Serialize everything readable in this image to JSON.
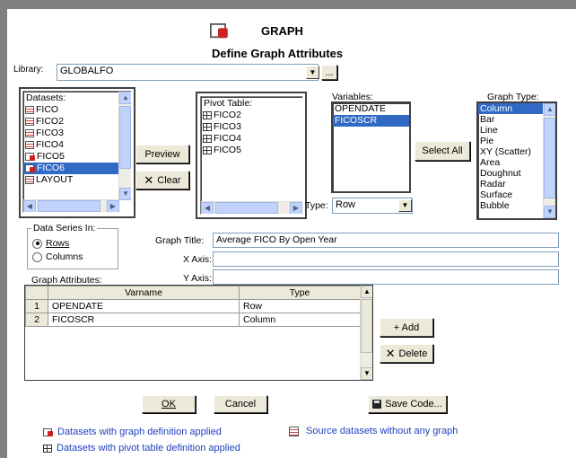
{
  "header": {
    "app_title": "GRAPH",
    "subtitle": "Define Graph Attributes"
  },
  "library": {
    "label": "Library:",
    "value": "GLOBALFO",
    "browse_label": "..."
  },
  "datasets": {
    "label": "Datasets:",
    "items": [
      {
        "name": "FICO",
        "icon": "source-dataset-icon",
        "selected": false
      },
      {
        "name": "FICO2",
        "icon": "source-dataset-icon",
        "selected": false
      },
      {
        "name": "FICO3",
        "icon": "source-dataset-icon",
        "selected": false
      },
      {
        "name": "FICO4",
        "icon": "source-dataset-icon",
        "selected": false
      },
      {
        "name": "FICO5",
        "icon": "graph-dataset-icon",
        "selected": false
      },
      {
        "name": "FICO6",
        "icon": "graph-dataset-icon",
        "selected": true
      },
      {
        "name": "LAYOUT",
        "icon": "source-dataset-icon",
        "selected": false
      }
    ]
  },
  "buttons": {
    "preview": "Preview",
    "clear": "Clear",
    "select_all": "Select All",
    "add": "+ Add",
    "delete": "Delete",
    "ok": "OK",
    "cancel": "Cancel",
    "save_code": "Save Code..."
  },
  "pivot_table": {
    "label": "Pivot Table:",
    "items": [
      "FICO2",
      "FICO3",
      "FICO4",
      "FICO5"
    ]
  },
  "variables": {
    "label": "Variables:",
    "items": [
      {
        "name": "OPENDATE",
        "selected": false
      },
      {
        "name": "FICOSCR",
        "selected": true
      }
    ]
  },
  "type_select": {
    "label": "Type:",
    "value": "Row"
  },
  "graph_type": {
    "label": "Graph Type:",
    "items": [
      "Column",
      "Bar",
      "Line",
      "Pie",
      "XY (Scatter)",
      "Area",
      "Doughnut",
      "Radar",
      "Surface",
      "Bubble"
    ],
    "selected_index": 0
  },
  "data_series": {
    "label": "Data Series In:",
    "options": [
      "Rows",
      "Columns"
    ],
    "selected": "Rows"
  },
  "graph_title": {
    "label": "Graph Title:",
    "value": "Average FICO By Open Year"
  },
  "x_axis": {
    "label": "X Axis:",
    "value": ""
  },
  "y_axis": {
    "label": "Y Axis:",
    "value": ""
  },
  "attributes": {
    "label": "Graph Attributes:",
    "columns": [
      "Varname",
      "Type"
    ],
    "rows": [
      {
        "num": "1",
        "varname": "OPENDATE",
        "type": "Row"
      },
      {
        "num": "2",
        "varname": "FICOSCR",
        "type": "Column"
      }
    ]
  },
  "legend": {
    "graph_def": "Datasets with graph definition applied",
    "source": "Source datasets without any graph",
    "pivot_def": "Datasets with pivot table definition applied"
  },
  "colors": {
    "selection": "#316ac5",
    "legend_text": "#1f3fbf",
    "window_bg": "#ffffff"
  }
}
